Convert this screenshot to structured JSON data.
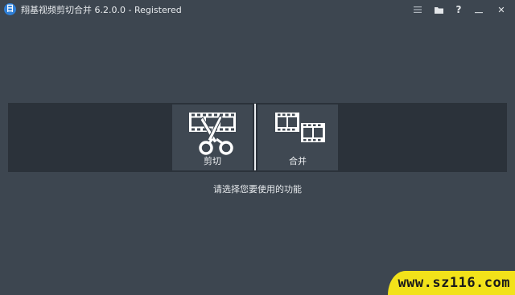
{
  "window": {
    "title": "翔基视频剪切合并 6.2.0.0 - Registered",
    "app_icon_glyph": "日"
  },
  "titlebar_buttons": [
    {
      "name": "menu-icon"
    },
    {
      "name": "folder-icon"
    },
    {
      "name": "help-icon",
      "glyph": "?"
    },
    {
      "name": "minimize-icon"
    },
    {
      "name": "close-icon",
      "glyph": "✕"
    }
  ],
  "tools": {
    "cut_label": "剪切",
    "merge_label": "合并"
  },
  "prompt": "请选择您要使用的功能",
  "watermark": "www.sz116.com",
  "colors": {
    "background": "#3d4650",
    "band": "#2b323a",
    "tool_bg": "#3f4852",
    "watermark_bg": "#f2e21a"
  }
}
